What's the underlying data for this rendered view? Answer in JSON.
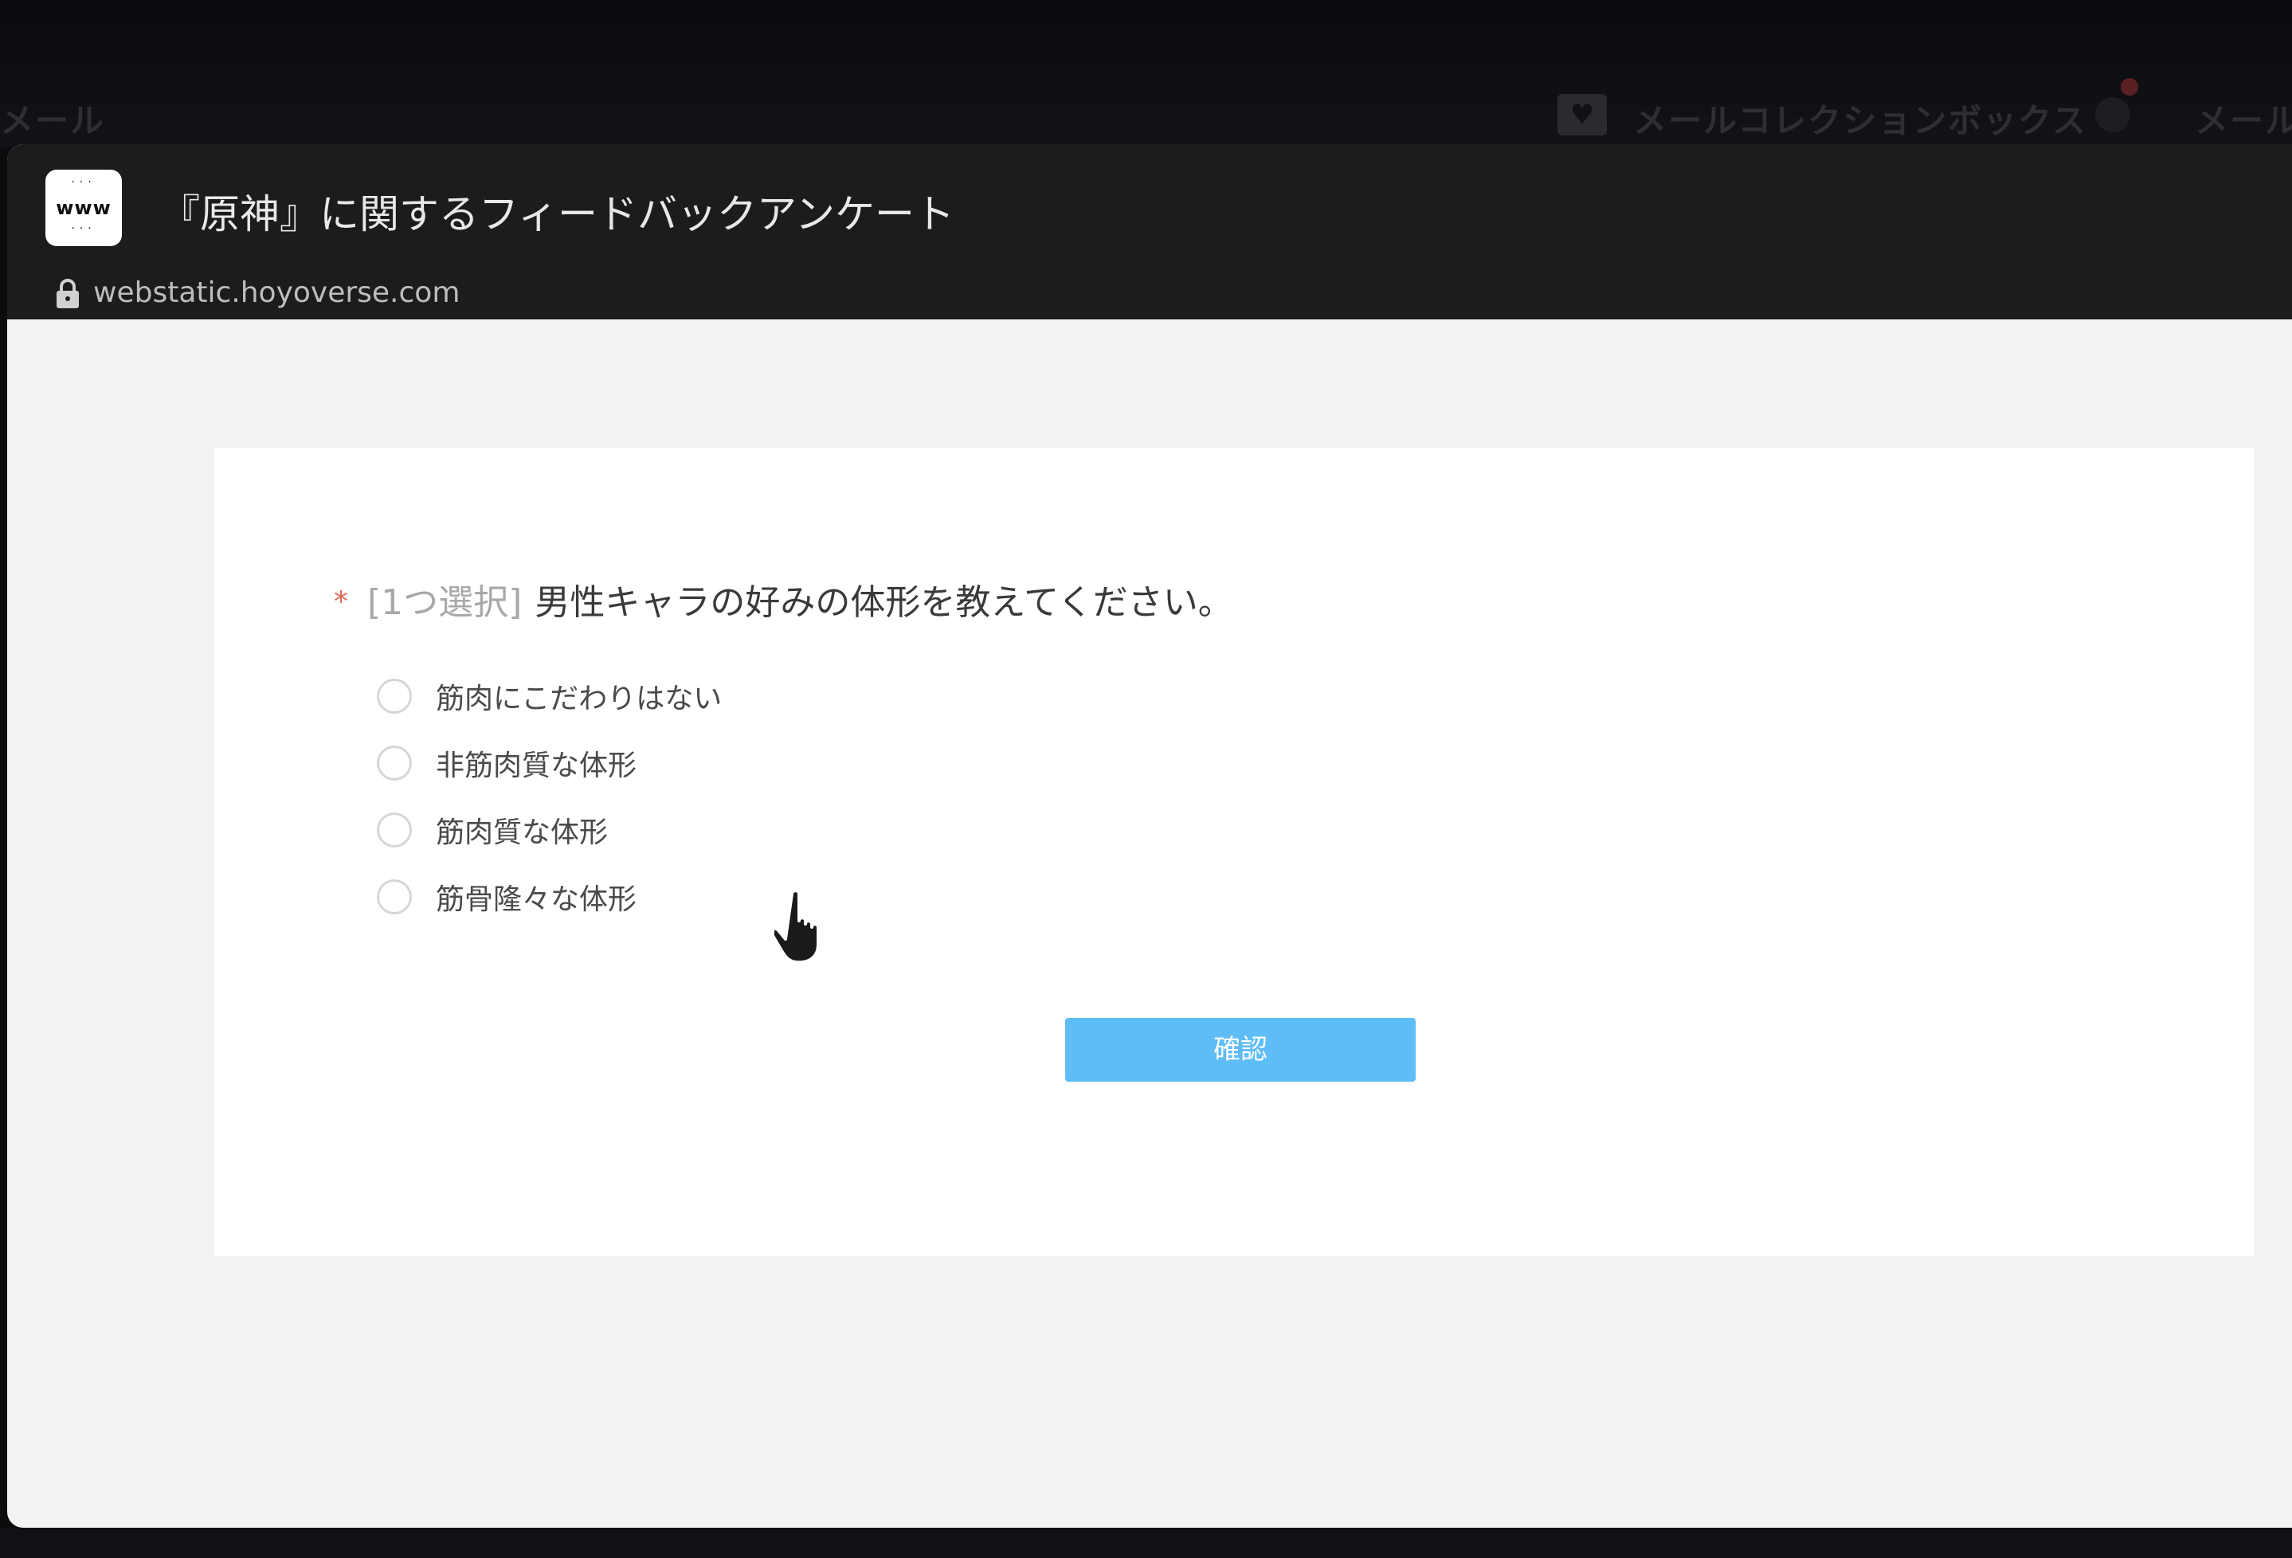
{
  "background": {
    "mail_left": "メール",
    "collection_box": "メールコレクションボックス",
    "mail_right": "メール"
  },
  "webview": {
    "title": "『原神』に関するフィードバックアンケート",
    "url": "webstatic.hoyoverse.com",
    "site_icon_text": "www"
  },
  "survey": {
    "required_mark": "*",
    "question_tag": "[1つ選択]",
    "question_text": "男性キャラの好みの体形を教えてください。",
    "options": [
      {
        "label": "筋肉にこだわりはない"
      },
      {
        "label": "非筋肉質な体形"
      },
      {
        "label": "筋肉質な体形"
      },
      {
        "label": "筋骨隆々な体形"
      }
    ],
    "confirm_label": "確認"
  },
  "colors": {
    "accent": "#5ebcf6",
    "required": "#e06a5c"
  }
}
